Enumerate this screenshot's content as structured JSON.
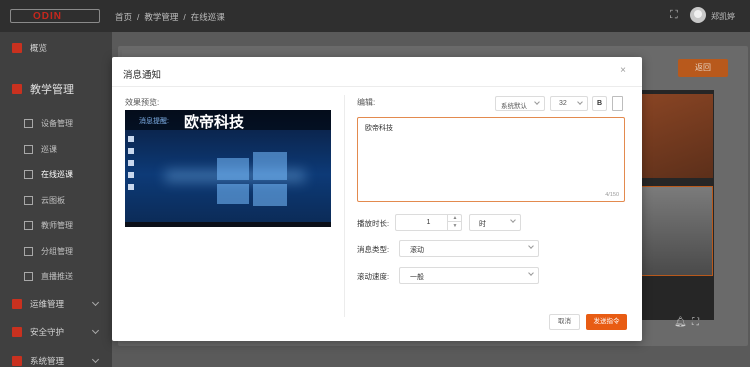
{
  "header": {
    "logo": "ODIN",
    "breadcrumb": [
      "首页",
      "教学管理",
      "在线巡课"
    ],
    "username": "郑凯婷"
  },
  "sidebar": {
    "overview": "概览",
    "teaching_group": "教学管理",
    "sub_items": [
      "设备管理",
      "巡课",
      "在线巡课",
      "云图板",
      "教师管理",
      "分组管理",
      "直播推送"
    ],
    "groups": [
      "运维管理",
      "安全守护",
      "系统管理"
    ]
  },
  "main": {
    "back_button": "返回"
  },
  "dialog": {
    "title": "消息通知",
    "close": "×",
    "preview_label": "效果预览:",
    "preview_tag": "消息提醒:",
    "preview_message": "欧帝科技",
    "edit_label": "编辑:",
    "font_family": "系统默认",
    "font_size": "32",
    "bold": "B",
    "content": "欧帝科技",
    "char_count": "4/150",
    "duration_label": "播放时长:",
    "duration_value": "1",
    "duration_unit": "时",
    "type_label": "消息类型:",
    "type_value": "滚动",
    "speed_label": "滚动速度:",
    "speed_value": "一般",
    "cancel_button": "取消",
    "send_button": "发送指令"
  },
  "colors": {
    "accent": "#e85c13",
    "topbar": "#2f2f2f",
    "sidebar": "#404040"
  }
}
